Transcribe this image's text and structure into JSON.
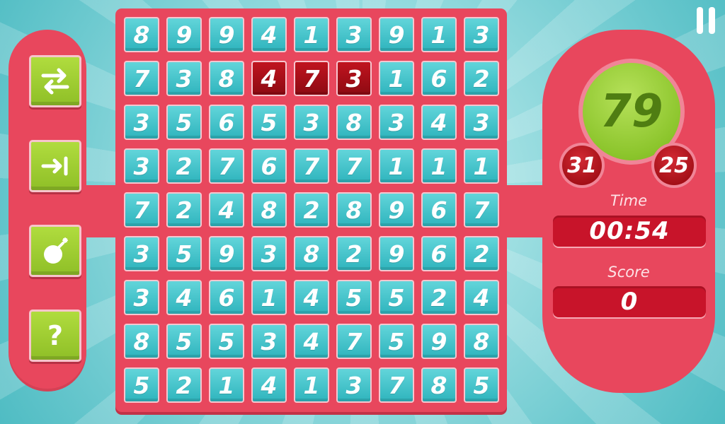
{
  "tools": [
    {
      "icon": "swap-arrows-icon",
      "label": ""
    },
    {
      "icon": "skip-arrow-icon",
      "label": ""
    },
    {
      "icon": "bomb-icon",
      "label": ""
    },
    {
      "icon": "help-icon",
      "label": "?"
    }
  ],
  "board": {
    "rows": [
      [
        "8",
        "9",
        "9",
        "4",
        "1",
        "3",
        "9",
        "1",
        "3"
      ],
      [
        "7",
        "3",
        "8",
        "4",
        "7",
        "3",
        "1",
        "6",
        "2"
      ],
      [
        "3",
        "5",
        "6",
        "5",
        "3",
        "8",
        "3",
        "4",
        "3"
      ],
      [
        "3",
        "2",
        "7",
        "6",
        "7",
        "7",
        "1",
        "1",
        "1"
      ],
      [
        "7",
        "2",
        "4",
        "8",
        "2",
        "8",
        "9",
        "6",
        "7"
      ],
      [
        "3",
        "5",
        "9",
        "3",
        "8",
        "2",
        "9",
        "6",
        "2"
      ],
      [
        "3",
        "4",
        "6",
        "1",
        "4",
        "5",
        "5",
        "2",
        "4"
      ],
      [
        "8",
        "5",
        "5",
        "3",
        "4",
        "7",
        "5",
        "9",
        "8"
      ],
      [
        "5",
        "2",
        "1",
        "4",
        "1",
        "3",
        "7",
        "8",
        "5"
      ]
    ],
    "selected": [
      [
        1,
        3
      ],
      [
        1,
        4
      ],
      [
        1,
        5
      ]
    ]
  },
  "target": "79",
  "sub_left": "31",
  "sub_right": "25",
  "time_label": "Time",
  "time_value": "00:54",
  "score_label": "Score",
  "score_value": "0",
  "pause_icon": "pause-icon",
  "colors": {
    "panel": "#e8475d",
    "tile": "#3fc2c9",
    "tile_selected": "#b0101a",
    "target": "#8cc52c",
    "tool_button": "#9fce32"
  }
}
